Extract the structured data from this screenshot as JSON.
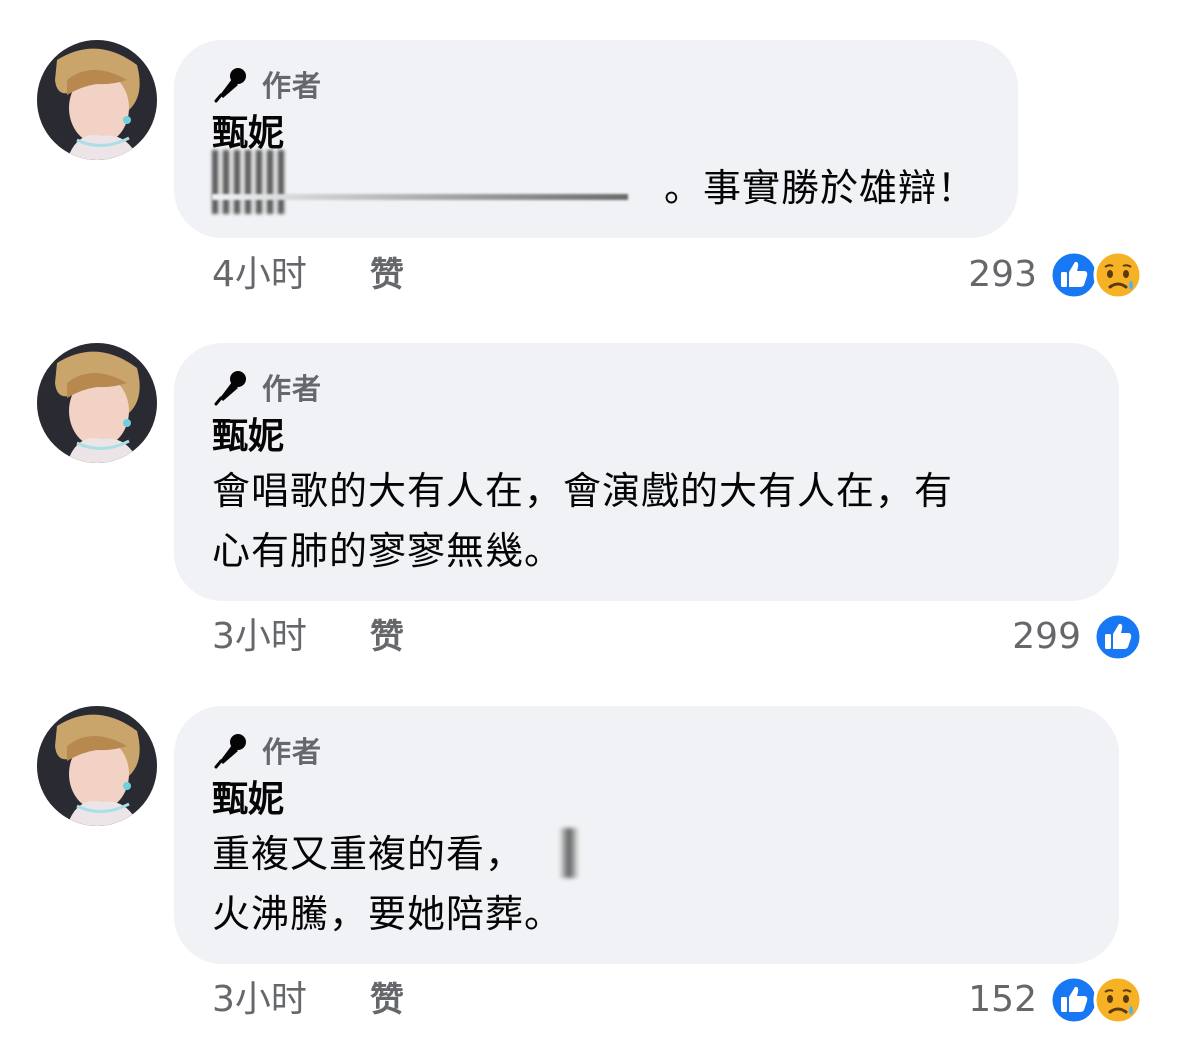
{
  "comments": [
    {
      "author_tag": "作者",
      "name": "甄妮",
      "text_lines": [
        "。事實勝於雄辯！"
      ],
      "time": "4小时",
      "like_label": "赞",
      "reaction_count": "293",
      "reactions": [
        "like-icon",
        "sad-icon"
      ]
    },
    {
      "author_tag": "作者",
      "name": "甄妮",
      "text_lines": [
        "會唱歌的大有人在，會演戲的大有人在，有",
        "心有肺的寥寥無幾。"
      ],
      "time": "3小时",
      "like_label": "赞",
      "reaction_count": "299",
      "reactions": [
        "like-icon"
      ]
    },
    {
      "author_tag": "作者",
      "name": "甄妮",
      "text_lines": [
        "重複又重複的看，",
        "火沸騰，要她陪葬。"
      ],
      "time": "3小时",
      "like_label": "赞",
      "reaction_count": "152",
      "reactions": [
        "like-icon",
        "sad-icon"
      ]
    }
  ],
  "colors": {
    "bubble": "#f0f2f5",
    "meta_text": "#65676b",
    "like_blue": "#1877f2",
    "sad_yellow": "#f7b125"
  }
}
